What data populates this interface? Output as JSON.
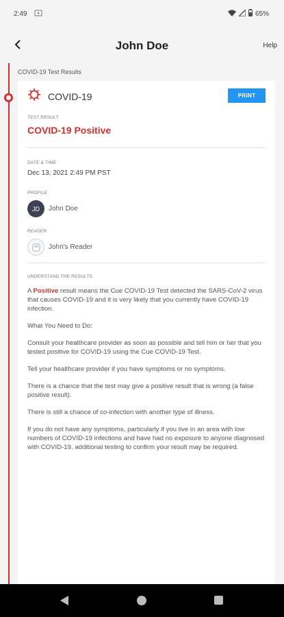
{
  "status_bar": {
    "time": "2:49",
    "cast_icon": "screen-cast-icon",
    "battery": "65%"
  },
  "header": {
    "title": "John Doe",
    "help": "Help",
    "back_icon": "chevron-left-icon"
  },
  "section": {
    "label": "COVID-19 Test Results"
  },
  "card": {
    "test_icon": "virus-icon",
    "test_name": "COVID-19",
    "print": "PRINT",
    "result_label": "TEST RESULT",
    "result_value": "COVID-19 Positive",
    "datetime_label": "DATE & TIME",
    "datetime_value": "Dec 13, 2021 2:49 PM PST",
    "profile_label": "PROFILE",
    "profile_initials": "JD",
    "profile_name": "John Doe",
    "reader_label": "READER",
    "reader_name": "John's Reader",
    "understand_label": "UNDERSTAND THE RESULTS",
    "explanation": {
      "prefix": "A ",
      "highlight": "Positive",
      "suffix": " result means the Cue COVID-19 Test detected the SARS-CoV-2 virus that causes COVID-19 and it is very likely that you currently have COVID-19 infection."
    },
    "what_to_do": "What You Need to Do:",
    "paragraphs": [
      "Consult your healthcare provider as soon as possible and tell him or her that you tested positive for COVID-19 using the Cue COVID-19 Test.",
      "Tell your healthcare provider if you have symptoms or no symptoms.",
      "There is a chance that the test may give a positive result that is wrong (a false positive result).",
      "There is still a chance of co-infection with another type of illness.",
      "If you do not have any symptoms, particularly if you live in an area with low numbers of COVID-19 infections and have had no exposure to anyone diagnosed with COVID-19, additional testing to confirm your result may be required."
    ]
  },
  "colors": {
    "accent_red": "#d32f2f",
    "print_blue": "#2196f3",
    "avatar_bg": "#3d4254"
  }
}
